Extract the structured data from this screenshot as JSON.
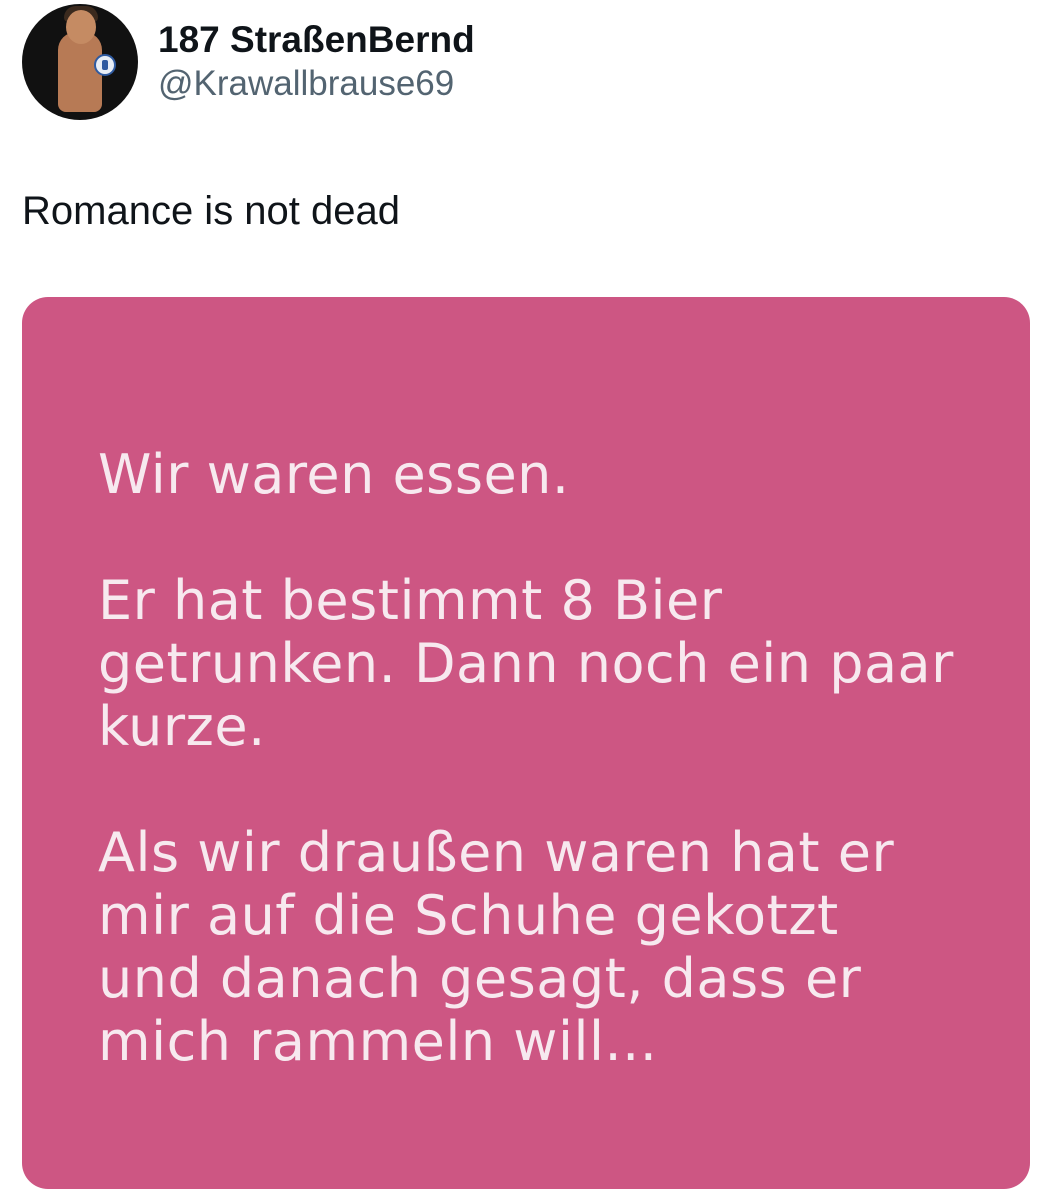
{
  "author": {
    "display_name": "187 StraßenBernd",
    "handle": "@Krawallbrause69"
  },
  "tweet": {
    "text": "Romance is not dead"
  },
  "media": {
    "background_color": "#cd5683",
    "paragraphs": [
      "Wir waren essen.",
      "Er hat bestimmt 8 Bier getrunken. Dann noch ein paar kurze.",
      "Als wir draußen waren hat er mir auf die Schuhe gekotzt und danach gesagt, dass er mich rammeln will..."
    ]
  }
}
